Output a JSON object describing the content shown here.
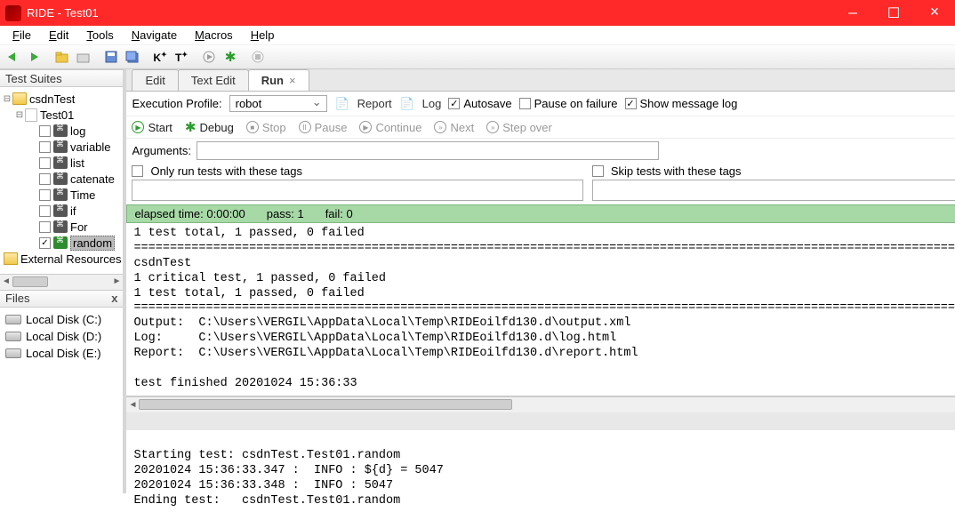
{
  "window": {
    "title": "RIDE - Test01"
  },
  "menu": {
    "file": "File",
    "edit": "Edit",
    "tools": "Tools",
    "navigate": "Navigate",
    "macros": "Macros",
    "help": "Help"
  },
  "panels": {
    "suites": "Test Suites",
    "files": "Files"
  },
  "tree": {
    "root": "csdnTest",
    "suite": "Test01",
    "items": [
      "log",
      "variable",
      "list",
      "catenate",
      "Time",
      "if",
      "For",
      "random"
    ],
    "checked_index": 7,
    "selected_index": 7,
    "external": "External Resources"
  },
  "drives": [
    "Local Disk (C:)",
    "Local Disk (D:)",
    "Local Disk (E:)"
  ],
  "tabs": {
    "edit": "Edit",
    "textedit": "Text Edit",
    "run": "Run"
  },
  "exec": {
    "profile_label": "Execution Profile:",
    "profile_value": "robot",
    "report": "Report",
    "log": "Log",
    "autosave": "Autosave",
    "pause_on_failure": "Pause on failure",
    "show_msg_log": "Show message log",
    "autosave_checked": true,
    "pause_checked": false,
    "show_msg_checked": true
  },
  "controls": {
    "start": "Start",
    "debug": "Debug",
    "stop": "Stop",
    "pause": "Pause",
    "continue": "Continue",
    "next": "Next",
    "stepover": "Step over"
  },
  "arguments_label": "Arguments:",
  "tags": {
    "only": "Only run tests with these tags",
    "skip": "Skip tests with these tags"
  },
  "status": {
    "elapsed": "elapsed time: 0:00:00",
    "pass": "pass: 1",
    "fail": "fail: 0"
  },
  "output_top": "1 test total, 1 passed, 0 failed\n==============================================================================================================================\ncsdnTest\n1 critical test, 1 passed, 0 failed\n1 test total, 1 passed, 0 failed\n==============================================================================================================================\nOutput:  C:\\Users\\VERGIL\\AppData\\Local\\Temp\\RIDEoilfd130.d\\output.xml\nLog:     C:\\Users\\VERGIL\\AppData\\Local\\Temp\\RIDEoilfd130.d\\log.html\nReport:  C:\\Users\\VERGIL\\AppData\\Local\\Temp\\RIDEoilfd130.d\\report.html\n\ntest finished 20201024 15:36:33",
  "output_bottom": "\nStarting test: csdnTest.Test01.random\n20201024 15:36:33.347 :  INFO : ${d} = 5047\n20201024 15:36:33.348 :  INFO : 5047\nEnding test:   csdnTest.Test01.random"
}
